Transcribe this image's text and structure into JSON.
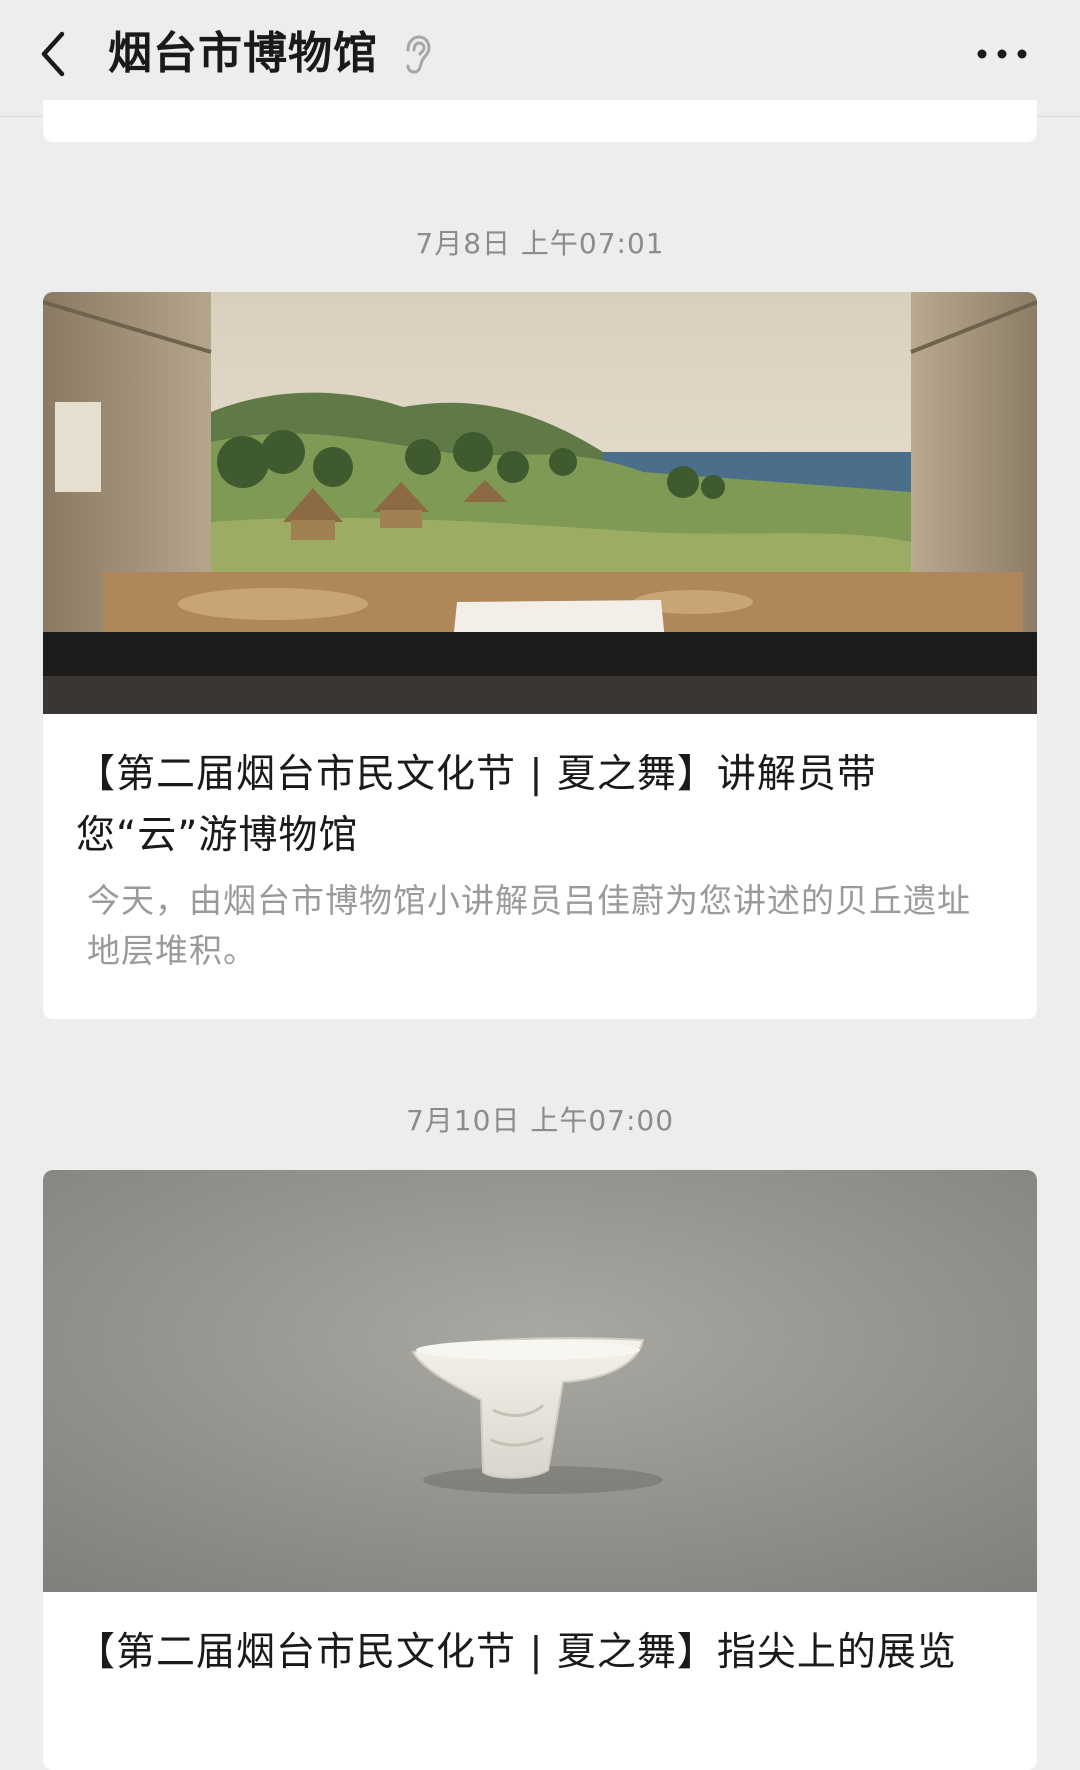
{
  "header": {
    "title": "烟台市博物馆",
    "back_icon": "chevron-left-icon",
    "ear_icon": "ear-icon",
    "more_icon": "more-dots-icon"
  },
  "messages": [
    {
      "timestamp": "7月8日 上午07:01",
      "title": "【第二届烟台市民文化节 | 夏之舞】讲解员带您“云”游博物馆",
      "description": "今天，由烟台市博物馆小讲解员吕佳蔚为您讲述的贝丘遗址地层堆积。"
    },
    {
      "timestamp": "7月10日 上午07:00",
      "title": "【第二届烟台市民文化节 | 夏之舞】指尖上的展览"
    }
  ]
}
